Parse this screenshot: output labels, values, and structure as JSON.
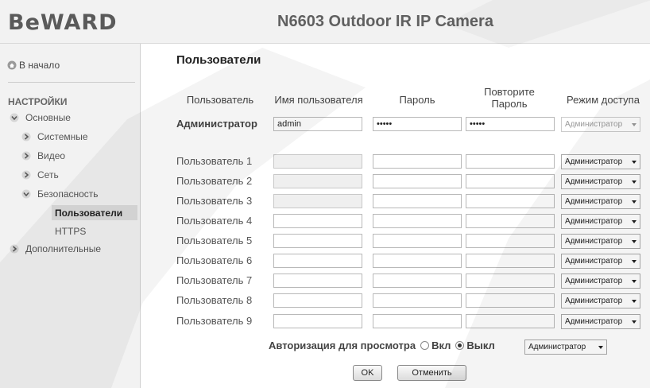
{
  "header": {
    "logo": "BeWARD",
    "title": "N6603 Outdoor IR IP Camera"
  },
  "sidebar": {
    "home": "В начало",
    "section": "НАСТРОЙКИ",
    "items": [
      {
        "label": "Основные",
        "expanded": true
      },
      {
        "label": "Системные",
        "expanded": false
      },
      {
        "label": "Видео",
        "expanded": false
      },
      {
        "label": "Сеть",
        "expanded": false
      },
      {
        "label": "Безопасность",
        "expanded": true
      },
      {
        "label": "Пользователи",
        "active": true
      },
      {
        "label": "HTTPS"
      },
      {
        "label": "Дополнительные",
        "expanded": false
      }
    ]
  },
  "main": {
    "title": "Пользователи",
    "headers": {
      "user": "Пользователь",
      "username": "Имя пользователя",
      "password": "Пароль",
      "repeat": "Повторите Пароль",
      "access": "Режим доступа"
    },
    "admin": {
      "label": "Администратор",
      "username": "admin",
      "password": "•••••",
      "repeat": "•••••",
      "access": "Администратор"
    },
    "users": [
      {
        "label": "Пользователь 1",
        "access": "Администратор",
        "disabled": true
      },
      {
        "label": "Пользователь 2",
        "access": "Администратор",
        "disabled": true
      },
      {
        "label": "Пользователь 3",
        "access": "Администратор",
        "disabled": true
      },
      {
        "label": "Пользователь 4",
        "access": "Администратор",
        "disabled": false
      },
      {
        "label": "Пользователь 5",
        "access": "Администратор",
        "disabled": false
      },
      {
        "label": "Пользователь 6",
        "access": "Администратор",
        "disabled": false
      },
      {
        "label": "Пользователь 7",
        "access": "Администратор",
        "disabled": false
      },
      {
        "label": "Пользователь 8",
        "access": "Администратор",
        "disabled": false
      },
      {
        "label": "Пользователь 9",
        "access": "Администратор",
        "disabled": false
      }
    ],
    "auth": {
      "label": "Авторизация для просмотра",
      "on_label": "Вкл",
      "off_label": "Выкл",
      "selected": "Выкл",
      "access": "Администратор"
    },
    "buttons": {
      "ok": "OK",
      "cancel": "Отменить"
    }
  }
}
